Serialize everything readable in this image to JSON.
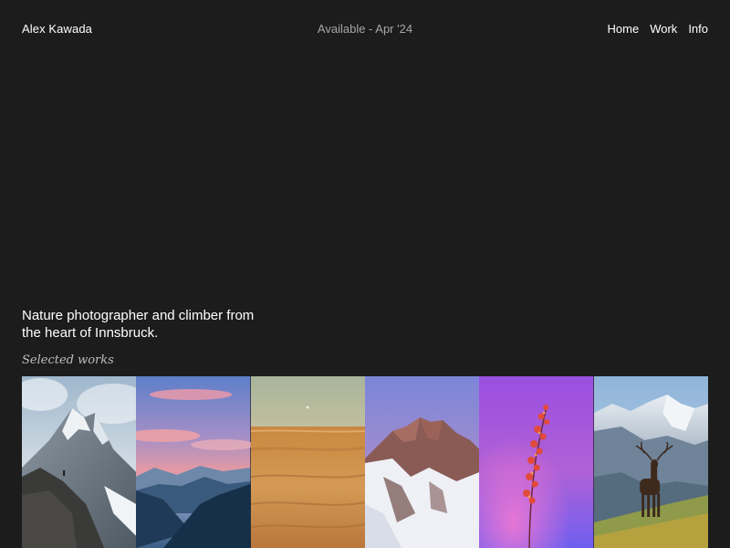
{
  "header": {
    "brand": "Alex Kawada",
    "availability": "Available - Apr '24",
    "nav": [
      "Home",
      "Work",
      "Info"
    ]
  },
  "intro": {
    "text": "Nature photographer and climber from the heart of Innsbruck."
  },
  "gallery": {
    "heading": "Selected works",
    "photos": [
      {
        "subject": "snowy-peak-climber-photo"
      },
      {
        "subject": "pink-sunset-mountains-photo"
      },
      {
        "subject": "desert-dunes-photo"
      },
      {
        "subject": "dolomites-snow-peaks-photo"
      },
      {
        "subject": "red-flower-purple-photo"
      },
      {
        "subject": "deer-alpine-meadow-photo"
      }
    ]
  },
  "colors": {
    "background": "#1c1c1c",
    "text": "#ffffff",
    "muted": "#a6a6a6"
  }
}
